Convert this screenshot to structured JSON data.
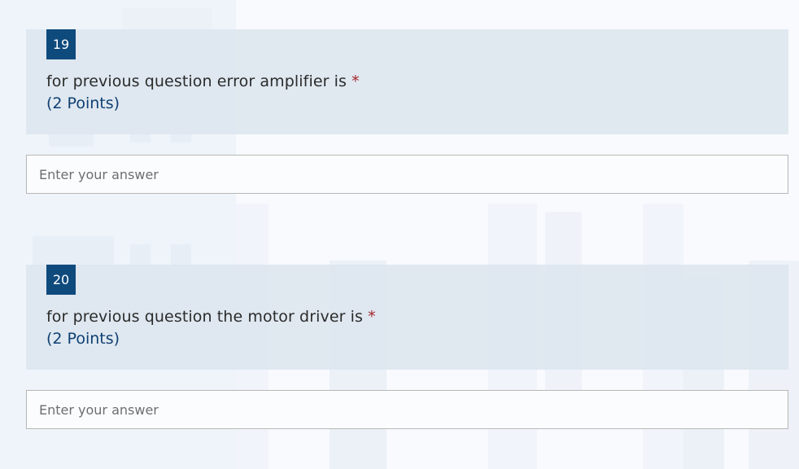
{
  "questions": [
    {
      "number": "19",
      "text": "for previous question error amplifier is",
      "required_mark": "*",
      "points": "(2 Points)",
      "answer_placeholder": "Enter your answer",
      "answer_value": ""
    },
    {
      "number": "20",
      "text": "for previous question the motor driver is",
      "required_mark": "*",
      "points": "(2 Points)",
      "answer_placeholder": "Enter your answer",
      "answer_value": ""
    }
  ],
  "colors": {
    "number_badge": "#0f4a7d",
    "required_mark": "#a4262c",
    "points_text": "#0f3f73",
    "question_band": "#dee6ef"
  }
}
